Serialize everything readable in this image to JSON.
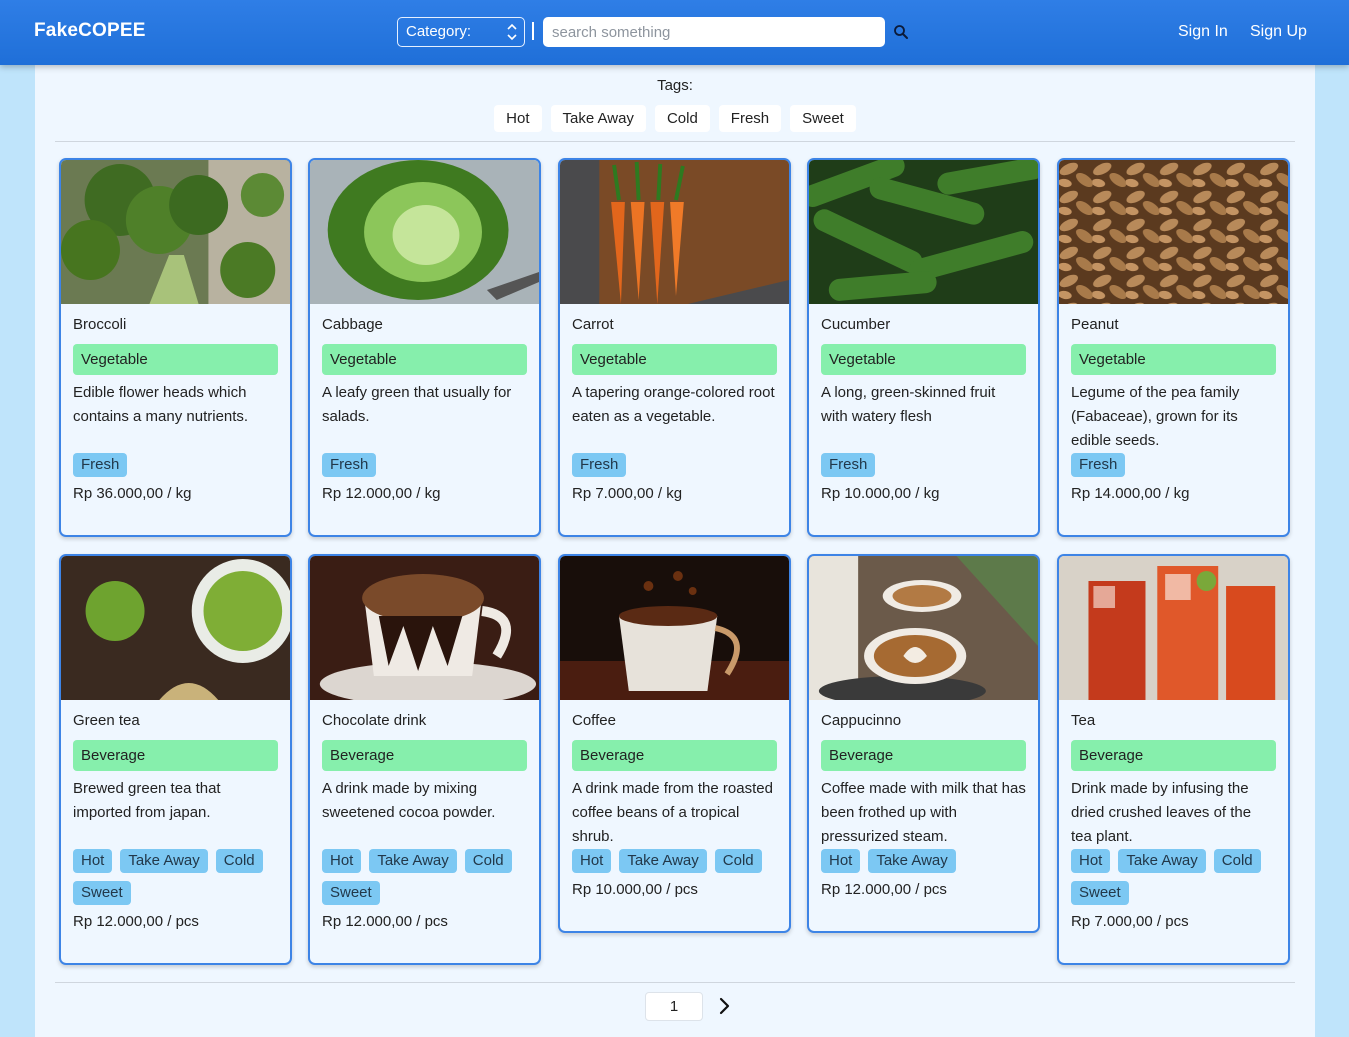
{
  "header": {
    "brand": "FakeCOPEE",
    "category_label": "Category:",
    "search_placeholder": "search something",
    "sign_in": "Sign In",
    "sign_up": "Sign Up"
  },
  "tags": {
    "title": "Tags:",
    "items": [
      "Hot",
      "Take Away",
      "Cold",
      "Fresh",
      "Sweet"
    ]
  },
  "products": [
    {
      "name": "Broccoli",
      "category": "Vegetable",
      "description": "Edible flower heads which contains a many nutrients.",
      "tags": [
        "Fresh"
      ],
      "price": "Rp 36.000,00 / kg",
      "image": "broccoli"
    },
    {
      "name": "Cabbage",
      "category": "Vegetable",
      "description": "A leafy green that usually for salads.",
      "tags": [
        "Fresh"
      ],
      "price": "Rp 12.000,00 / kg",
      "image": "cabbage"
    },
    {
      "name": "Carrot",
      "category": "Vegetable",
      "description": "A tapering orange-colored root eaten as a vegetable.",
      "tags": [
        "Fresh"
      ],
      "price": "Rp 7.000,00 / kg",
      "image": "carrot"
    },
    {
      "name": "Cucumber",
      "category": "Vegetable",
      "description": "A long, green-skinned fruit with watery flesh",
      "tags": [
        "Fresh"
      ],
      "price": "Rp 10.000,00 / kg",
      "image": "cucumber"
    },
    {
      "name": "Peanut",
      "category": "Vegetable",
      "description": "Legume of the pea family (Fabaceae), grown for its edible seeds.",
      "tags": [
        "Fresh"
      ],
      "price": "Rp 14.000,00 / kg",
      "image": "peanut"
    },
    {
      "name": "Green tea",
      "category": "Beverage",
      "description": "Brewed green tea that imported from japan.",
      "tags": [
        "Hot",
        "Take Away",
        "Cold",
        "Sweet"
      ],
      "price": "Rp 12.000,00 / pcs",
      "image": "green-tea"
    },
    {
      "name": "Chocolate drink",
      "category": "Beverage",
      "description": "A drink made by mixing sweetened cocoa powder.",
      "tags": [
        "Hot",
        "Take Away",
        "Cold",
        "Sweet"
      ],
      "price": "Rp 12.000,00 / pcs",
      "image": "chocolate"
    },
    {
      "name": "Coffee",
      "category": "Beverage",
      "description": "A drink made from the roasted coffee beans of a tropical shrub.",
      "tags": [
        "Hot",
        "Take Away",
        "Cold"
      ],
      "price": "Rp 10.000,00 / pcs",
      "image": "coffee"
    },
    {
      "name": "Cappucinno",
      "category": "Beverage",
      "description": "Coffee made with milk that has been frothed up with pressurized steam.",
      "tags": [
        "Hot",
        "Take Away"
      ],
      "price": "Rp 12.000,00 / pcs",
      "image": "cappuccino"
    },
    {
      "name": "Tea",
      "category": "Beverage",
      "description": "Drink made by infusing the dried crushed leaves of the tea plant.",
      "tags": [
        "Hot",
        "Take Away",
        "Cold",
        "Sweet"
      ],
      "price": "Rp 7.000,00 / pcs",
      "image": "tea"
    }
  ],
  "pagination": {
    "current_page": "1"
  },
  "colors": {
    "header": "#2f7ee6",
    "panel": "#eff7ff",
    "card_border": "#3d84e6",
    "category_badge": "#86efac",
    "tag_chip": "#7cc8f3"
  }
}
